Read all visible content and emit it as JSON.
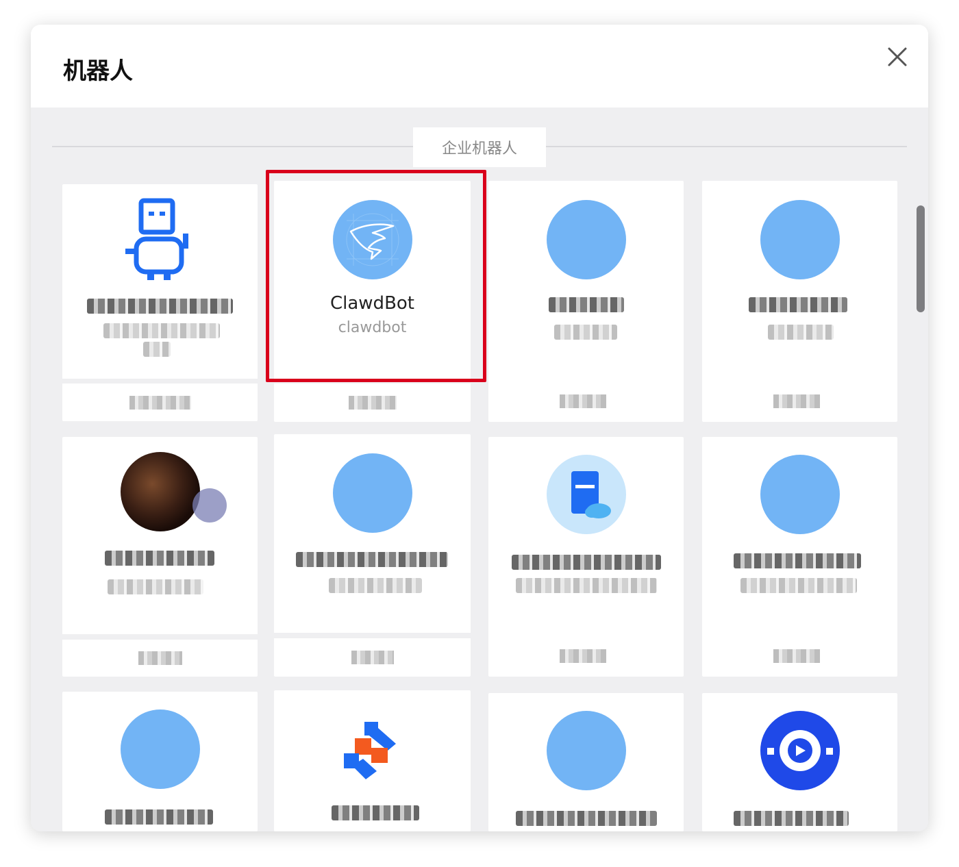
{
  "dialog": {
    "title": "机器人",
    "close_label": "×"
  },
  "section": {
    "label": "企业机器人"
  },
  "featured_bot": {
    "name": "ClawdBot",
    "handle": "clawdbot"
  },
  "colors": {
    "highlight": "#d9001b",
    "avatar_blue": "#72b4f5",
    "brand_blue": "#1f6cf2"
  },
  "icons": {
    "close": "close-icon",
    "featured_avatar": "wing-logo-icon",
    "robot": "robot-mascot-icon"
  }
}
